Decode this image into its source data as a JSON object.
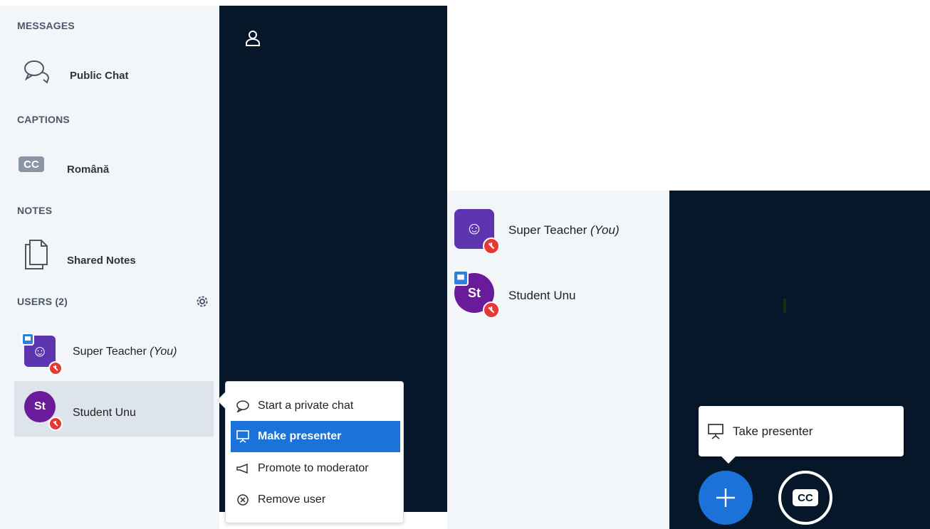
{
  "left": {
    "sections": {
      "messages": "MESSAGES",
      "captions": "CAPTIONS",
      "notes": "NOTES",
      "users": "USERS (2)"
    },
    "public_chat": "Public Chat",
    "caption_lang": "Română",
    "shared_notes": "Shared Notes",
    "users": [
      {
        "name": "Super Teacher",
        "suffix": "(You)",
        "avatar_text": "☺",
        "avatar_color": "#5e35b1"
      },
      {
        "name": "Student Unu",
        "suffix": "",
        "avatar_text": "St",
        "avatar_color": "#6a1b9a"
      }
    ],
    "context_menu": [
      {
        "label": "Start a private chat",
        "icon": "chat-bubble-icon"
      },
      {
        "label": "Make presenter",
        "icon": "presentation-icon"
      },
      {
        "label": "Promote to moderator",
        "icon": "megaphone-icon"
      },
      {
        "label": "Remove user",
        "icon": "remove-circle-icon"
      }
    ]
  },
  "right": {
    "users": [
      {
        "name": "Super Teacher",
        "suffix": "(You)",
        "avatar_text": "☺"
      },
      {
        "name": "Student Unu",
        "suffix": "",
        "avatar_text": "St"
      }
    ],
    "take_presenter": "Take presenter",
    "cc_label": "CC"
  },
  "colors": {
    "accent": "#1b72d8",
    "dark_bg": "#06172a",
    "sidebar_bg": "#f3f6f9",
    "mic_muted": "#e53935"
  }
}
